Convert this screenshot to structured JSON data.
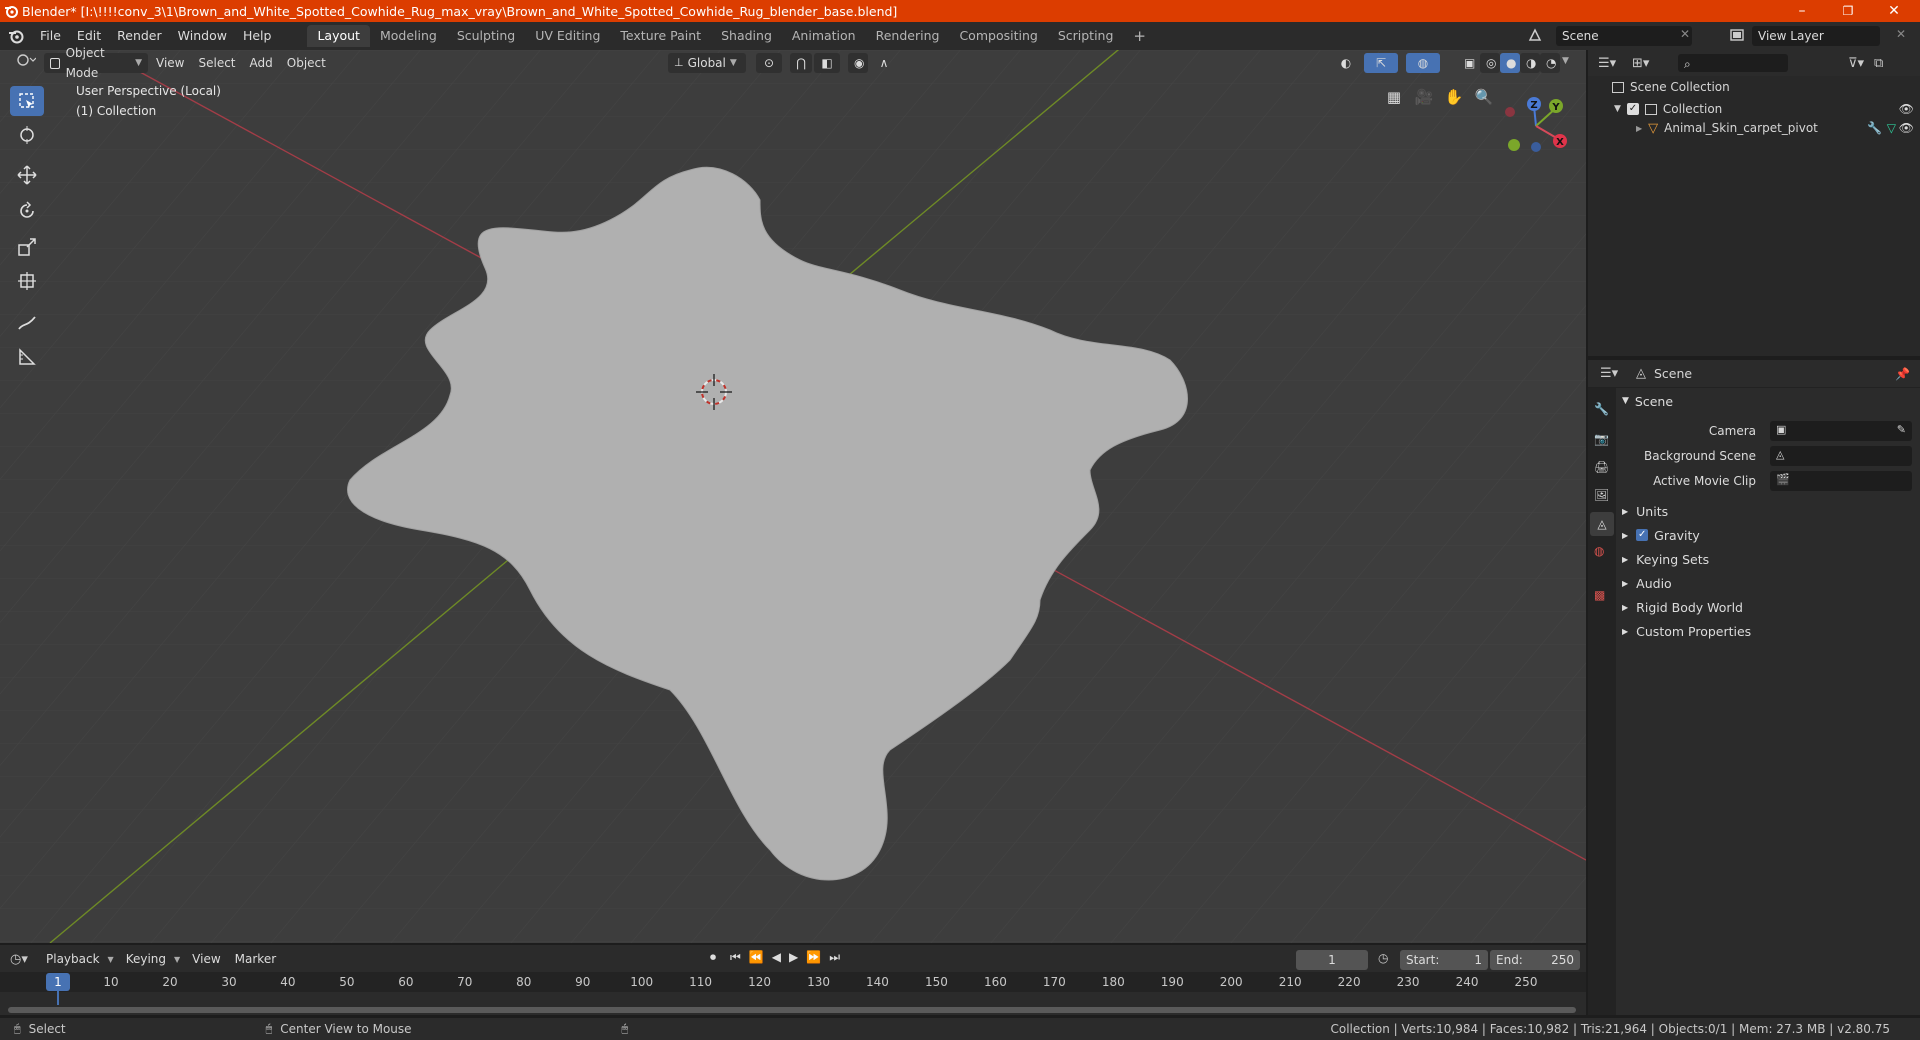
{
  "window": {
    "title": "Blender* [I:\\!!!!conv_3\\1\\Brown_and_White_Spotted_Cowhide_Rug_max_vray\\Brown_and_White_Spotted_Cowhide_Rug_blender_base.blend]",
    "minimize": "–",
    "maximize": "❐",
    "close": "✕"
  },
  "menubar": {
    "items": [
      "File",
      "Edit",
      "Render",
      "Window",
      "Help"
    ]
  },
  "workspaces": {
    "tabs": [
      "Layout",
      "Modeling",
      "Sculpting",
      "UV Editing",
      "Texture Paint",
      "Shading",
      "Animation",
      "Rendering",
      "Compositing",
      "Scripting"
    ],
    "active": "Layout",
    "add": "+"
  },
  "scene_selector": {
    "value": "Scene"
  },
  "viewlayer_selector": {
    "value": "View Layer"
  },
  "viewport": {
    "mode": "Object Mode",
    "menus": [
      "View",
      "Select",
      "Add",
      "Object"
    ],
    "transform_orientation": "Global",
    "overlay_title": "User Perspective (Local)",
    "overlay_subtitle": "(1) Collection",
    "gizmo": {
      "x": "X",
      "y": "Y",
      "z": "Z"
    }
  },
  "outliner": {
    "root": "Scene Collection",
    "collection": "Collection",
    "object": "Animal_Skin_carpet_pivot"
  },
  "properties": {
    "context": "Scene",
    "section": "Scene",
    "fields": [
      {
        "label": "Camera"
      },
      {
        "label": "Background Scene"
      },
      {
        "label": "Active Movie Clip"
      }
    ],
    "panels": [
      "Units",
      "Gravity",
      "Keying Sets",
      "Audio",
      "Rigid Body World",
      "Custom Properties"
    ]
  },
  "timeline": {
    "menus": [
      "Playback",
      "Keying",
      "View",
      "Marker"
    ],
    "current_frame": "1",
    "start_label": "Start:",
    "start": "1",
    "end_label": "End:",
    "end": "250",
    "ticks": [
      "1",
      "10",
      "20",
      "30",
      "40",
      "50",
      "60",
      "70",
      "80",
      "90",
      "100",
      "110",
      "120",
      "130",
      "140",
      "150",
      "160",
      "170",
      "180",
      "190",
      "200",
      "210",
      "220",
      "230",
      "240",
      "250"
    ]
  },
  "statusbar": {
    "left": "Select",
    "middle": "Center View to Mouse",
    "right": "Collection | Verts:10,984 | Faces:10,982 | Tris:21,964 | Objects:0/1 | Mem: 27.3 MB | v2.80.75"
  }
}
